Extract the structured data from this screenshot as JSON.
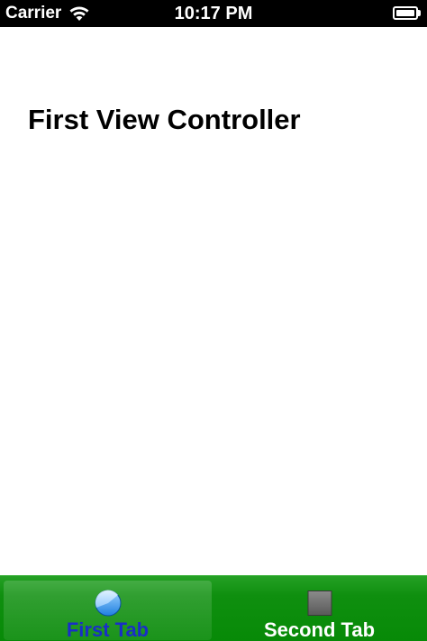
{
  "status_bar": {
    "carrier": "Carrier",
    "time": "10:17 PM",
    "wifi_icon": "wifi-icon",
    "battery_icon": "battery-icon",
    "battery_level": 1.0
  },
  "content": {
    "title": "First View Controller"
  },
  "tab_bar": {
    "background_color": "#0f8f0f",
    "selected_index": 0,
    "tabs": [
      {
        "label": "First Tab",
        "icon": "pie-icon",
        "color": "#1a2ec8"
      },
      {
        "label": "Second Tab",
        "icon": "square-icon",
        "color": "#ffffff"
      }
    ]
  }
}
